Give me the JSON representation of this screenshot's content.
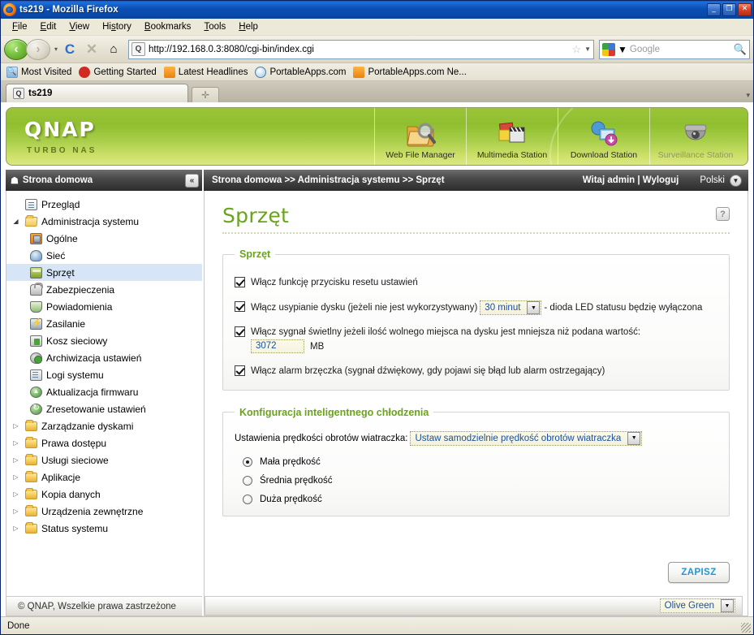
{
  "browser": {
    "window_title": "ts219 - Mozilla Firefox",
    "minimize_label": "_",
    "maximize_label": "❐",
    "close_label": "✕",
    "menu": [
      {
        "label": "File"
      },
      {
        "label": "Edit"
      },
      {
        "label": "View"
      },
      {
        "label": "History"
      },
      {
        "label": "Bookmarks"
      },
      {
        "label": "Tools"
      },
      {
        "label": "Help"
      }
    ],
    "nav": {
      "back_glyph": "‹",
      "forward_glyph": "›",
      "reload_glyph": "C",
      "stop_glyph": "✕",
      "home_glyph": "⌂",
      "url": "http://192.168.0.3:8080/cgi-bin/index.cgi",
      "site_icon_glyph": "Q",
      "star_glyph": "☆",
      "dropdown_glyph": "▼"
    },
    "search": {
      "engine": "google-icon",
      "placeholder": "Google",
      "magnifier_glyph": "🔍"
    },
    "bookmarks": [
      {
        "label": "Most Visited",
        "icon": "most-visited-icon"
      },
      {
        "label": "Getting Started",
        "icon": "firefox-getting-started-icon"
      },
      {
        "label": "Latest Headlines",
        "icon": "rss-feed-icon"
      },
      {
        "label": "PortableApps.com",
        "icon": "portableapps-icon"
      },
      {
        "label": "PortableApps.com Ne...",
        "icon": "rss-feed-icon"
      }
    ],
    "tab": {
      "title": "ts219",
      "favicon_glyph": "Q",
      "new_tab_glyph": "✛",
      "tab_list_glyph": "▾"
    },
    "status": "Done"
  },
  "qnap": {
    "brand": "QNAP",
    "tagline": "TURBO NAS",
    "stations": [
      {
        "label": "Web File Manager",
        "icon": "folder-search-icon",
        "enabled": true
      },
      {
        "label": "Multimedia Station",
        "icon": "photo-clapper-icon",
        "enabled": true
      },
      {
        "label": "Download Station",
        "icon": "download-monitor-icon",
        "enabled": true
      },
      {
        "label": "Surveillance Station",
        "icon": "dome-camera-icon",
        "enabled": false
      }
    ],
    "crumb": {
      "home_label": "Strona domowa",
      "home_icon": "home-icon",
      "collapse_glyph": "«",
      "path": "Strona domowa >> Administracja systemu >> Sprzęt",
      "welcome": "Witaj admin | Wyloguj",
      "language": "Polski",
      "language_arrow_glyph": "▼"
    },
    "sidebar": {
      "items": [
        {
          "label": "Przegląd",
          "level": 1,
          "icon": "overview-icon",
          "twist": "",
          "selected": false
        },
        {
          "label": "Administracja systemu",
          "level": 1,
          "icon": "folder-open-icon",
          "twist": "◢",
          "selected": false
        },
        {
          "label": "Ogólne",
          "level": 2,
          "icon": "general-icon",
          "twist": "",
          "selected": false
        },
        {
          "label": "Sieć",
          "level": 2,
          "icon": "network-icon",
          "twist": "",
          "selected": false
        },
        {
          "label": "Sprzęt",
          "level": 2,
          "icon": "hardware-icon",
          "twist": "",
          "selected": true
        },
        {
          "label": "Zabezpieczenia",
          "level": 2,
          "icon": "security-lock-icon",
          "twist": "",
          "selected": false
        },
        {
          "label": "Powiadomienia",
          "level": 2,
          "icon": "notification-icon",
          "twist": "",
          "selected": false
        },
        {
          "label": "Zasilanie",
          "level": 2,
          "icon": "power-icon",
          "twist": "",
          "selected": false
        },
        {
          "label": "Kosz sieciowy",
          "level": 2,
          "icon": "network-recycle-bin-icon",
          "twist": "",
          "selected": false
        },
        {
          "label": "Archiwizacja ustawień",
          "level": 2,
          "icon": "backup-settings-icon",
          "twist": "",
          "selected": false
        },
        {
          "label": "Logi systemu",
          "level": 2,
          "icon": "system-logs-icon",
          "twist": "",
          "selected": false
        },
        {
          "label": "Aktualizacja firmwaru",
          "level": 2,
          "icon": "firmware-update-icon",
          "twist": "",
          "selected": false
        },
        {
          "label": "Zresetowanie ustawień",
          "level": 2,
          "icon": "reset-settings-icon",
          "twist": "",
          "selected": false
        },
        {
          "label": "Zarządzanie dyskami",
          "level": 1,
          "icon": "folder-icon",
          "twist": "▷",
          "selected": false
        },
        {
          "label": "Prawa dostępu",
          "level": 1,
          "icon": "folder-icon",
          "twist": "▷",
          "selected": false
        },
        {
          "label": "Usługi sieciowe",
          "level": 1,
          "icon": "folder-icon",
          "twist": "▷",
          "selected": false
        },
        {
          "label": "Aplikacje",
          "level": 1,
          "icon": "folder-icon",
          "twist": "▷",
          "selected": false
        },
        {
          "label": "Kopia danych",
          "level": 1,
          "icon": "folder-icon",
          "twist": "▷",
          "selected": false
        },
        {
          "label": "Urządzenia zewnętrzne",
          "level": 1,
          "icon": "folder-icon",
          "twist": "▷",
          "selected": false
        },
        {
          "label": "Status systemu",
          "level": 1,
          "icon": "folder-icon",
          "twist": "▷",
          "selected": false
        }
      ],
      "copyright": "© QNAP, Wszelkie prawa zastrzeżone"
    },
    "main": {
      "page_title": "Sprzęt",
      "help_glyph": "?",
      "hardware_panel": {
        "legend": "Sprzęt",
        "reset_button": {
          "label": "Włącz funkcję przycisku resetu ustawień",
          "checked": true
        },
        "disk_standby": {
          "label_before": "Włącz usypianie dysku (jeżeli nie jest wykorzystywany)",
          "select_value": "30 minut",
          "label_after": "- dioda LED statusu będzię wyłączona",
          "checked": true,
          "arrow_glyph": "▼"
        },
        "free_space_alert": {
          "label": "Włącz sygnał świetlny jeżeli ilość wolnego miejsca na dysku jest mniejsza niż podana wartość:",
          "value": "3072",
          "unit": "MB",
          "checked": true
        },
        "buzzer": {
          "label": "Włącz alarm brzęczka (sygnał dźwiękowy, gdy pojawi się błąd lub alarm ostrzegający)",
          "checked": true
        }
      },
      "cooling_panel": {
        "legend": "Konfiguracja inteligentnego chłodzenia",
        "fan_label": "Ustawienia prędkości obrotów wiatraczka:",
        "fan_select_value": "Ustaw samodzielnie prędkość obrotów wiatraczka",
        "arrow_glyph": "▼",
        "speeds": [
          {
            "label": "Mała prędkość",
            "selected": true
          },
          {
            "label": "Średnia prędkość",
            "selected": false
          },
          {
            "label": "Duża prędkość",
            "selected": false
          }
        ]
      },
      "save_label": "ZAPISZ",
      "theme_select_value": "Olive Green",
      "theme_arrow_glyph": "▼"
    }
  },
  "colors": {
    "brand_green": "#6aa31c",
    "header_green": "#9cc43a",
    "link_blue": "#1a4f9c",
    "save_blue": "#2196d6",
    "selection_blue": "#d6e6f7"
  }
}
